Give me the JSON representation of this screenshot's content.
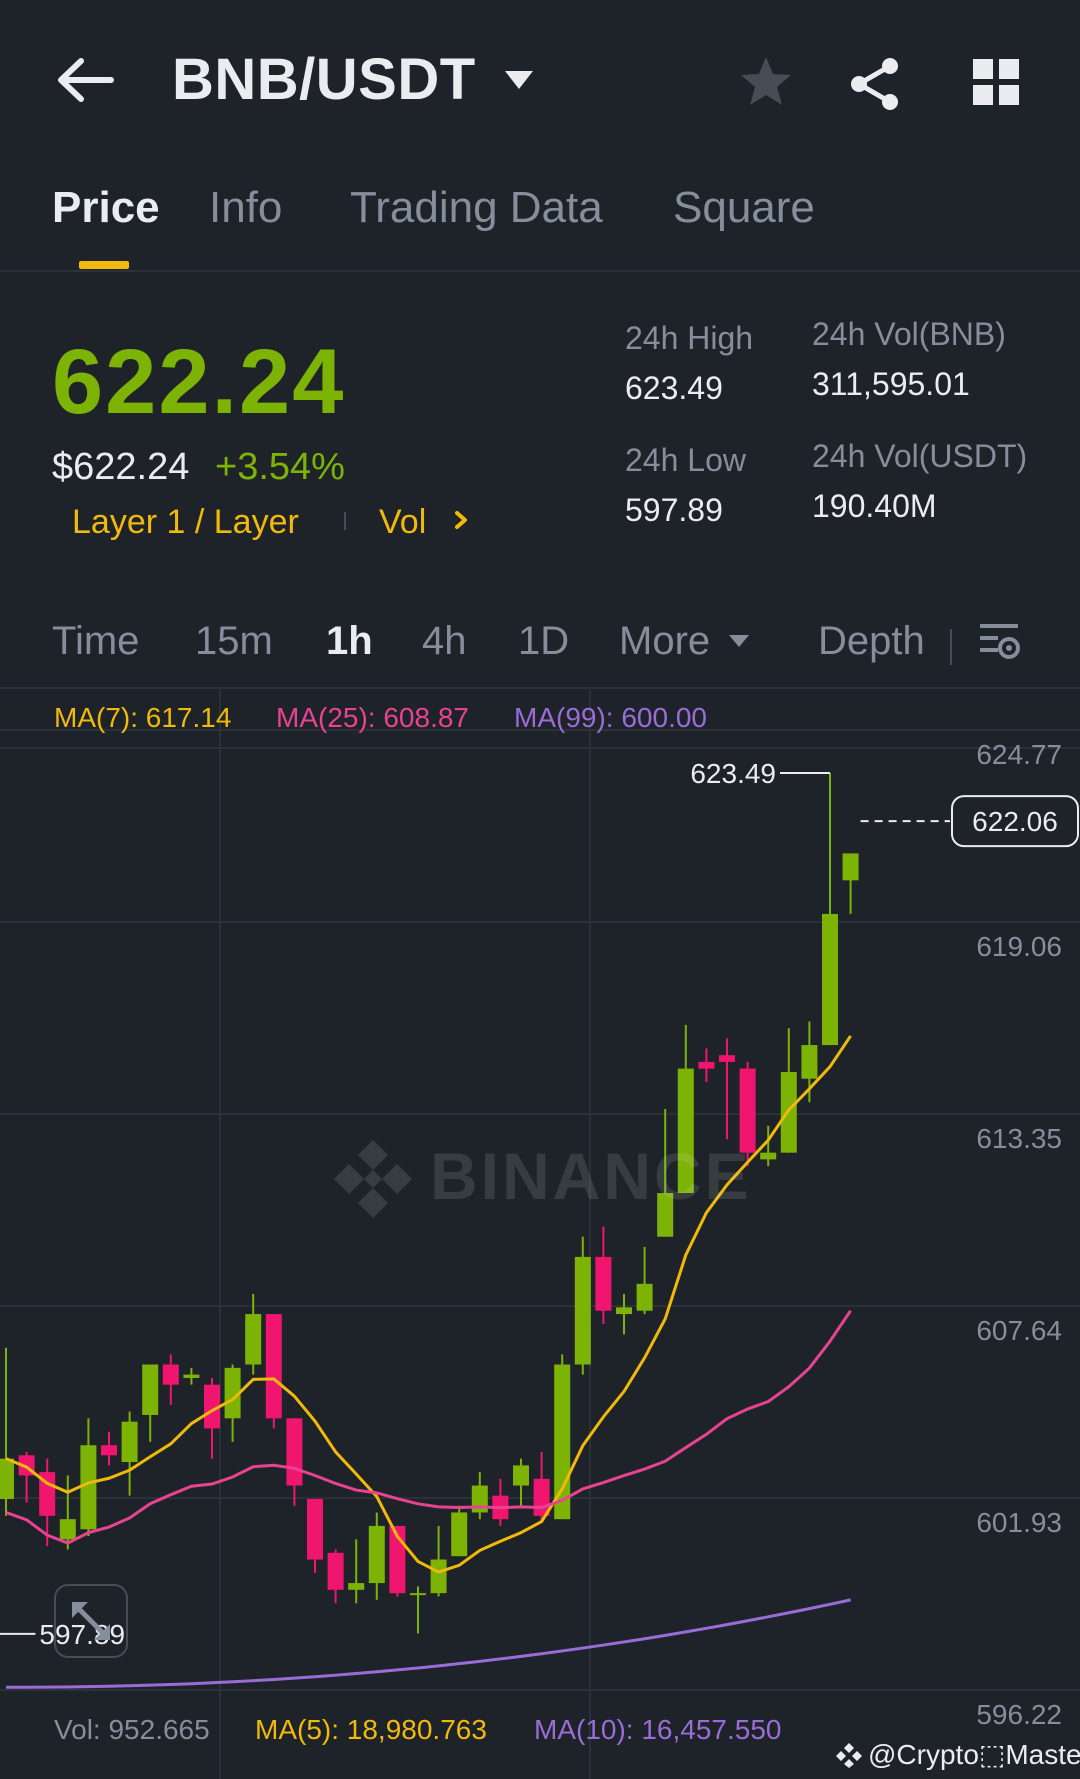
{
  "header": {
    "pair": "BNB/USDT",
    "icons": [
      "back-arrow-icon",
      "caret-down-icon",
      "star-icon",
      "share-icon",
      "grid-icon"
    ]
  },
  "tabs": [
    {
      "label": "Price",
      "active": true
    },
    {
      "label": "Info",
      "active": false
    },
    {
      "label": "Trading Data",
      "active": false
    },
    {
      "label": "Square",
      "active": false
    }
  ],
  "ticker": {
    "last_price": "622.24",
    "usd_price": "$622.24",
    "change_pct": "+3.54%",
    "tag_category": "Layer 1 / Layer",
    "tag_vol": "Vol",
    "high_label": "24h High",
    "high_value": "623.49",
    "low_label": "24h Low",
    "low_value": "597.89",
    "vol_base_label": "24h Vol(BNB)",
    "vol_base_value": "311,595.01",
    "vol_quote_label": "24h Vol(USDT)",
    "vol_quote_value": "190.40M"
  },
  "intervals": {
    "items": [
      "Time",
      "15m",
      "1h",
      "4h",
      "1D",
      "More",
      "Depth"
    ],
    "active": "1h"
  },
  "indicators": {
    "ma7": "MA(7): 617.14",
    "ma25": "MA(25): 608.87",
    "ma99": "MA(99): 600.00",
    "vol": "Vol: 952.665",
    "vol_ma5": "MA(5): 18,980.763",
    "vol_ma10": "MA(10): 16,457.550"
  },
  "watermark": "BINANCE",
  "author": "@Crypto⬚Master",
  "colors": {
    "up": "#7cb305",
    "down": "#f0166f",
    "ma7": "#f0b90b",
    "ma25": "#e84393",
    "ma99": "#9b6cd6",
    "background": "#1e2329"
  },
  "chart_data": {
    "type": "candlestick",
    "y_ticks": [
      "624.77",
      "619.06",
      "613.35",
      "607.64",
      "601.93",
      "596.22"
    ],
    "ylim": [
      596.22,
      624.77
    ],
    "current_price_label": "622.06",
    "high_marker": "623.49",
    "low_marker": "597.89",
    "candles": [
      {
        "o": 601.9,
        "h": 606.4,
        "l": 601.4,
        "c": 603.1
      },
      {
        "o": 603.2,
        "h": 603.3,
        "l": 601.8,
        "c": 602.6
      },
      {
        "o": 602.7,
        "h": 603.1,
        "l": 600.5,
        "c": 601.4
      },
      {
        "o": 600.7,
        "h": 602.6,
        "l": 600.4,
        "c": 601.3
      },
      {
        "o": 601.0,
        "h": 604.3,
        "l": 600.8,
        "c": 603.5
      },
      {
        "o": 603.5,
        "h": 603.9,
        "l": 602.9,
        "c": 603.2
      },
      {
        "o": 603.0,
        "h": 604.5,
        "l": 602.0,
        "c": 604.2
      },
      {
        "o": 604.4,
        "h": 605.7,
        "l": 603.6,
        "c": 605.9
      },
      {
        "o": 605.9,
        "h": 606.2,
        "l": 604.7,
        "c": 605.3
      },
      {
        "o": 605.5,
        "h": 605.8,
        "l": 605.3,
        "c": 605.6
      },
      {
        "o": 605.3,
        "h": 605.5,
        "l": 603.1,
        "c": 604.0
      },
      {
        "o": 604.3,
        "h": 605.9,
        "l": 603.6,
        "c": 605.8
      },
      {
        "o": 605.9,
        "h": 608.0,
        "l": 605.6,
        "c": 607.4
      },
      {
        "o": 607.4,
        "h": 607.4,
        "l": 604.0,
        "c": 604.3
      },
      {
        "o": 604.3,
        "h": 604.3,
        "l": 601.7,
        "c": 602.3
      },
      {
        "o": 601.9,
        "h": 601.9,
        "l": 599.7,
        "c": 600.1
      },
      {
        "o": 600.3,
        "h": 600.4,
        "l": 598.8,
        "c": 599.2
      },
      {
        "o": 599.2,
        "h": 600.7,
        "l": 598.8,
        "c": 599.4
      },
      {
        "o": 599.4,
        "h": 601.5,
        "l": 598.9,
        "c": 601.1
      },
      {
        "o": 601.1,
        "h": 601.1,
        "l": 599.0,
        "c": 599.1
      },
      {
        "o": 599.1,
        "h": 599.3,
        "l": 597.9,
        "c": 599.1
      },
      {
        "o": 599.1,
        "h": 601.1,
        "l": 599.0,
        "c": 600.1
      },
      {
        "o": 600.2,
        "h": 601.7,
        "l": 600.2,
        "c": 601.5
      },
      {
        "o": 601.5,
        "h": 602.7,
        "l": 601.3,
        "c": 602.3
      },
      {
        "o": 602.0,
        "h": 602.5,
        "l": 601.1,
        "c": 601.3
      },
      {
        "o": 602.3,
        "h": 603.1,
        "l": 601.7,
        "c": 602.9
      },
      {
        "o": 602.5,
        "h": 603.3,
        "l": 601.2,
        "c": 601.4
      },
      {
        "o": 601.3,
        "h": 606.2,
        "l": 601.3,
        "c": 605.9
      },
      {
        "o": 605.9,
        "h": 609.7,
        "l": 605.6,
        "c": 609.1
      },
      {
        "o": 609.1,
        "h": 610.0,
        "l": 607.1,
        "c": 607.5
      },
      {
        "o": 607.4,
        "h": 608.0,
        "l": 606.8,
        "c": 607.6
      },
      {
        "o": 607.5,
        "h": 609.4,
        "l": 607.4,
        "c": 608.3
      },
      {
        "o": 609.7,
        "h": 613.5,
        "l": 609.7,
        "c": 611.0
      },
      {
        "o": 611.0,
        "h": 616.0,
        "l": 611.0,
        "c": 614.7
      },
      {
        "o": 614.9,
        "h": 615.3,
        "l": 614.3,
        "c": 614.7
      },
      {
        "o": 615.1,
        "h": 615.6,
        "l": 612.6,
        "c": 614.9
      },
      {
        "o": 614.7,
        "h": 614.9,
        "l": 611.8,
        "c": 612.2
      },
      {
        "o": 612.0,
        "h": 613.0,
        "l": 611.8,
        "c": 612.2
      },
      {
        "o": 612.2,
        "h": 615.9,
        "l": 612.2,
        "c": 614.6
      },
      {
        "o": 614.4,
        "h": 616.1,
        "l": 613.7,
        "c": 615.4
      },
      {
        "o": 615.4,
        "h": 623.49,
        "l": 615.4,
        "c": 619.3
      },
      {
        "o": 620.3,
        "h": 620.9,
        "l": 619.3,
        "c": 621.1
      }
    ]
  }
}
